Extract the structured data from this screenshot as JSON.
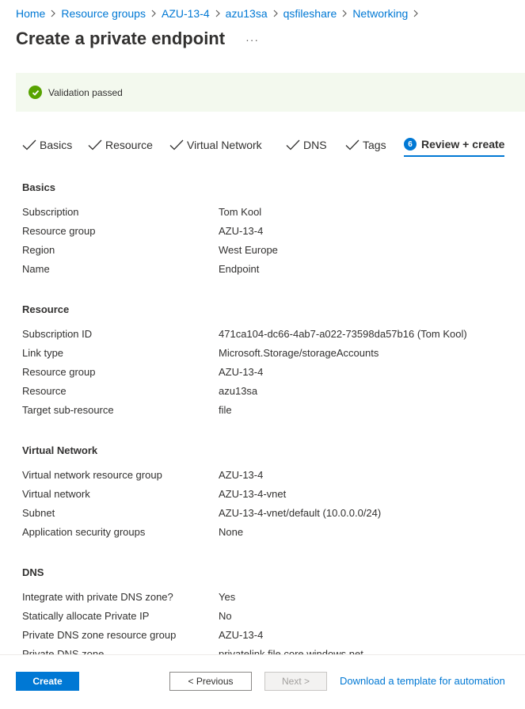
{
  "breadcrumb": {
    "items": [
      "Home",
      "Resource groups",
      "AZU-13-4",
      "azu13sa",
      "qsfileshare",
      "Networking"
    ]
  },
  "header": {
    "title": "Create a private endpoint",
    "more_label": "···"
  },
  "banner": {
    "text": "Validation passed",
    "color": "#57a300"
  },
  "tabs": [
    {
      "label": "Basics",
      "state": "done"
    },
    {
      "label": "Resource",
      "state": "done"
    },
    {
      "label": "Virtual Network",
      "state": "done"
    },
    {
      "label": "DNS",
      "state": "done"
    },
    {
      "label": "Tags",
      "state": "done"
    },
    {
      "label": "Review + create",
      "state": "active",
      "number": "6"
    }
  ],
  "sections": {
    "basics": {
      "title": "Basics",
      "rows": [
        {
          "key": "Subscription",
          "value": "Tom Kool"
        },
        {
          "key": "Resource group",
          "value": "AZU-13-4"
        },
        {
          "key": "Region",
          "value": "West Europe"
        },
        {
          "key": "Name",
          "value": "Endpoint"
        }
      ]
    },
    "resource": {
      "title": "Resource",
      "rows": [
        {
          "key": "Subscription ID",
          "value": "471ca104-dc66-4ab7-a022-73598da57b16 (Tom Kool)"
        },
        {
          "key": "Link type",
          "value": "Microsoft.Storage/storageAccounts"
        },
        {
          "key": "Resource group",
          "value": "AZU-13-4"
        },
        {
          "key": "Resource",
          "value": "azu13sa"
        },
        {
          "key": "Target sub-resource",
          "value": "file"
        }
      ]
    },
    "vnet": {
      "title": "Virtual Network",
      "rows": [
        {
          "key": "Virtual network resource group",
          "value": "AZU-13-4"
        },
        {
          "key": "Virtual network",
          "value": "AZU-13-4-vnet"
        },
        {
          "key": "Subnet",
          "value": "AZU-13-4-vnet/default (10.0.0.0/24)"
        },
        {
          "key": "Application security groups",
          "value": "None"
        }
      ]
    },
    "dns": {
      "title": "DNS",
      "rows": [
        {
          "key": "Integrate with private DNS zone?",
          "value": "Yes"
        },
        {
          "key": "Statically allocate Private IP",
          "value": "No"
        },
        {
          "key": "Private DNS zone resource group",
          "value": "AZU-13-4"
        },
        {
          "key": "Private DNS zone",
          "value": "privatelink.file.core.windows.net"
        }
      ]
    }
  },
  "footer": {
    "create_label": "Create",
    "previous_label": "< Previous",
    "next_label": "Next >",
    "download_label": "Download a template for automation"
  },
  "colors": {
    "accent": "#0078d4",
    "success": "#57a300",
    "banner_bg": "#f3f9ee"
  }
}
